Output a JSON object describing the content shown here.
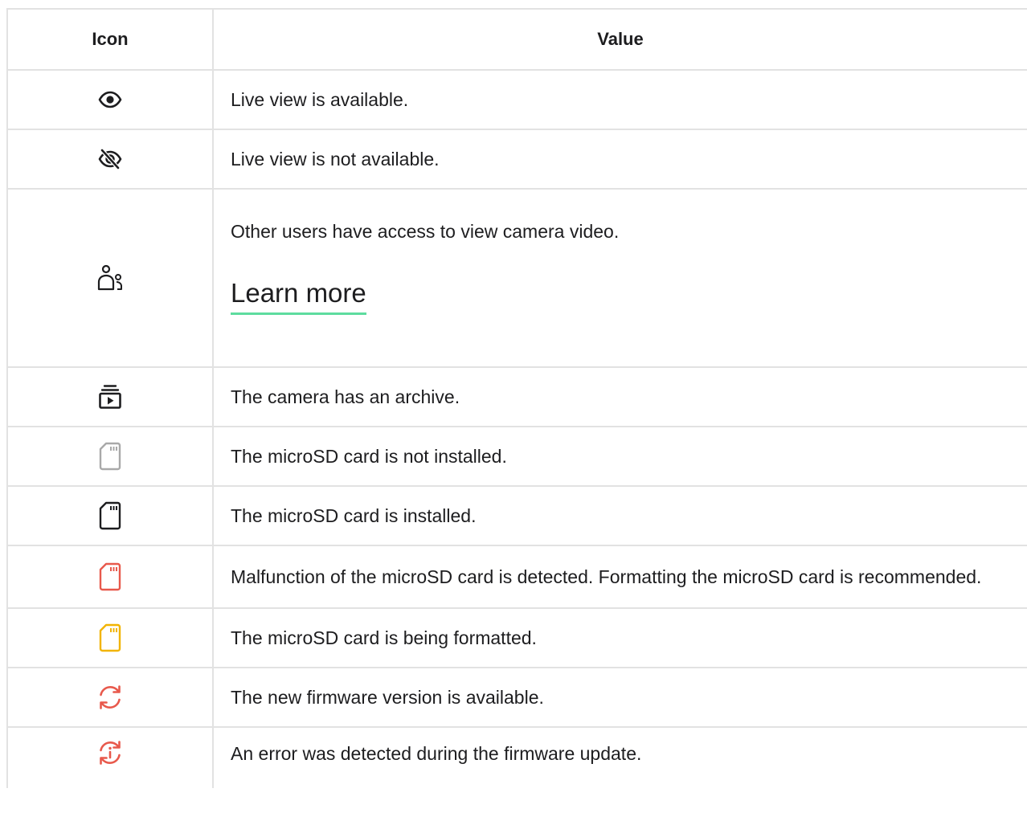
{
  "table": {
    "headers": {
      "icon": "Icon",
      "value": "Value"
    },
    "rows": [
      {
        "icon": "eye-icon",
        "text": "Live view is available."
      },
      {
        "icon": "eye-off-icon",
        "text": "Live view is not available."
      },
      {
        "icon": "users-icon",
        "text": "Other users have access to view camera video.",
        "link": "Learn more"
      },
      {
        "icon": "archive-icon",
        "text": "The camera has an archive."
      },
      {
        "icon": "sd-card-icon",
        "text": "The microSD card is not installed.",
        "color": "#a9a9a9"
      },
      {
        "icon": "sd-card-icon",
        "text": "The microSD card is installed.",
        "color": "#1d1d1f"
      },
      {
        "icon": "sd-card-icon",
        "text": "Malfunction of the microSD card is detected. Formatting the microSD card is recommended.",
        "color": "#e8594c"
      },
      {
        "icon": "sd-card-icon",
        "text": "The microSD card is being formatted.",
        "color": "#f2b400"
      },
      {
        "icon": "refresh-icon",
        "text": "The new firmware version is available.",
        "color": "#e8594c"
      },
      {
        "icon": "refresh-info-icon",
        "text": "An error was detected during the firmware update.",
        "color": "#e8594c"
      }
    ],
    "accent_underline": "#5ddc9f",
    "border_color": "#e2e2e2"
  }
}
